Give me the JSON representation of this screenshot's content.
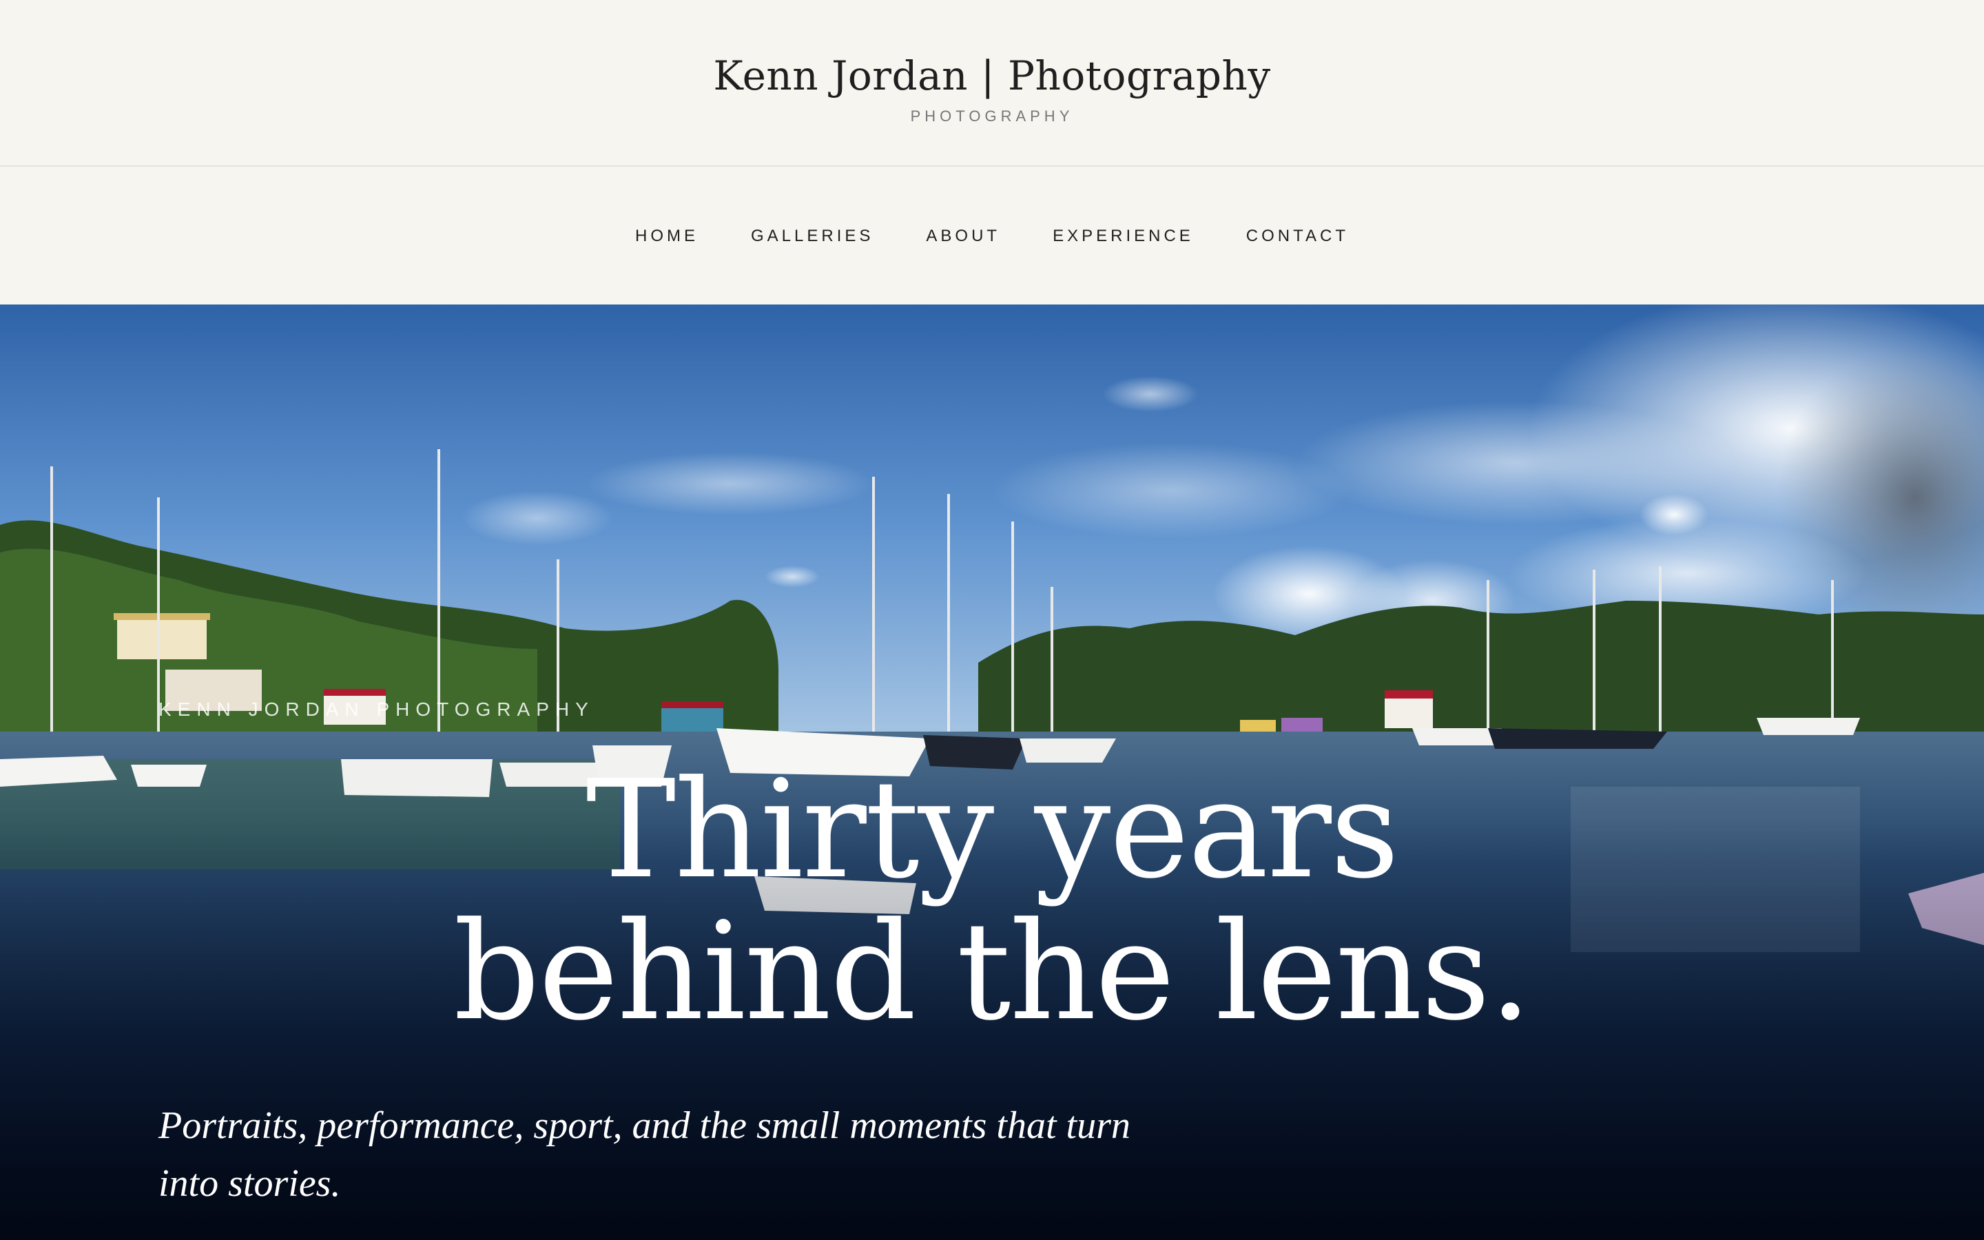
{
  "header": {
    "title": "Kenn Jordan | Photography",
    "subtitle": "PHOTOGRAPHY"
  },
  "nav": {
    "items": [
      {
        "label": "HOME"
      },
      {
        "label": "GALLERIES"
      },
      {
        "label": "ABOUT"
      },
      {
        "label": "EXPERIENCE"
      },
      {
        "label": "CONTACT"
      }
    ]
  },
  "hero": {
    "watermark": "KENN JORDAN PHOTOGRAPHY",
    "heading_line1": "Thirty years",
    "heading_line2": "behind the lens.",
    "tagline": "Portraits, performance, sport, and the small moments that turn into stories."
  },
  "colors": {
    "header_bg": "#f7f5f0",
    "text": "#1f1f1f",
    "muted": "#777777",
    "hero_text": "#ffffff"
  }
}
